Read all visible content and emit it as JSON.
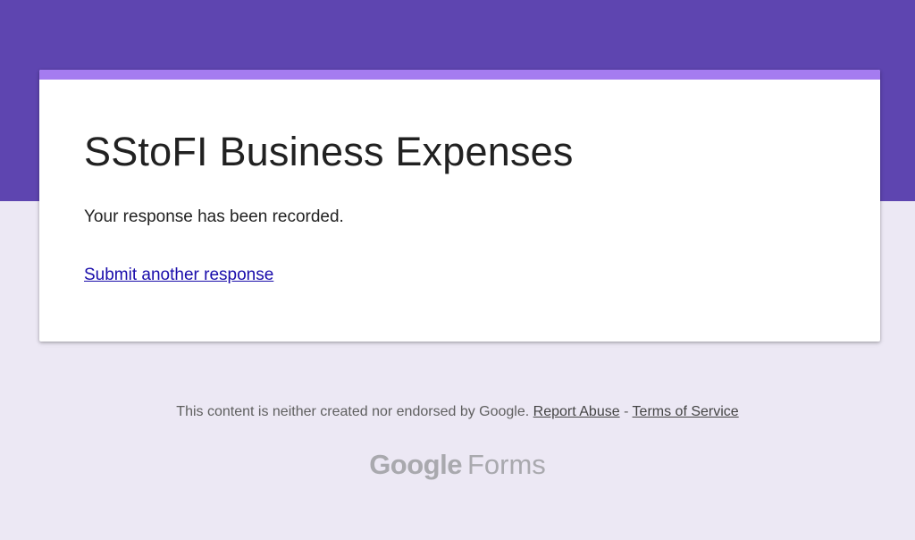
{
  "colors": {
    "header_band": "#5e45b0",
    "card_accent": "#a57cf0",
    "page_background": "#ece8f4",
    "link": "#1a0dab"
  },
  "form": {
    "title": "SStoFI Business Expenses",
    "confirmation": "Your response has been recorded.",
    "submit_another_label": "Submit another response"
  },
  "footer": {
    "disclaimer": "This content is neither created nor endorsed by Google.",
    "report_abuse_label": "Report Abuse",
    "separator": "-",
    "terms_label": "Terms of Service"
  },
  "brand": {
    "google": "Google",
    "product": "Forms"
  }
}
